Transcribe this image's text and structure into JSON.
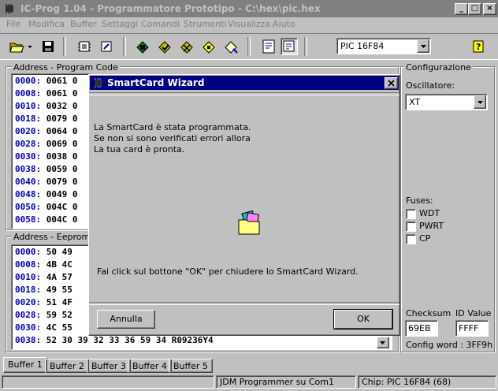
{
  "window": {
    "title": "IC-Prog 1.04 - Programmatore Prototipo - C:\\hex\\pic.hex",
    "buttons": [
      "_",
      "□",
      "×"
    ]
  },
  "menu": [
    "File",
    "Modifica",
    "Buffer",
    "Settaggi",
    "Comandi",
    "Strumenti",
    "Visualizza",
    "Aiuto"
  ],
  "toolbar": {
    "chip_select": "PIC 16F84",
    "icons": [
      "open-folder-icon",
      "dropdown-arrow-icon",
      "save-disk-icon",
      "chip-read-icon",
      "chip-write-icon",
      "program-icon",
      "verify-icon",
      "erase-icon",
      "blank-check-icon",
      "device-icon",
      "hex-view-icon",
      "window-icon",
      "help-icon"
    ]
  },
  "program_code": {
    "label": "Address - Program Code",
    "rows": [
      {
        "addr": "0000:",
        "data": "0061 0"
      },
      {
        "addr": "0008:",
        "data": "0061 0"
      },
      {
        "addr": "0010:",
        "data": "0032 0"
      },
      {
        "addr": "0018:",
        "data": "0079 0"
      },
      {
        "addr": "0020:",
        "data": "0064 0"
      },
      {
        "addr": "0028:",
        "data": "0069 0"
      },
      {
        "addr": "0030:",
        "data": "0038 0"
      },
      {
        "addr": "0038:",
        "data": "0059 0"
      },
      {
        "addr": "0040:",
        "data": "0079 0"
      },
      {
        "addr": "0048:",
        "data": "0049 0"
      },
      {
        "addr": "0050:",
        "data": "004C 0"
      },
      {
        "addr": "0058:",
        "data": "004C 0"
      }
    ]
  },
  "eeprom": {
    "label": "Address - Eeprom D",
    "rows": [
      {
        "addr": "0000:",
        "data": "50 49"
      },
      {
        "addr": "0008:",
        "data": "4B 4C"
      },
      {
        "addr": "0010:",
        "data": "4A 57"
      },
      {
        "addr": "0018:",
        "data": "49 55"
      },
      {
        "addr": "0020:",
        "data": "51 4F"
      },
      {
        "addr": "0028:",
        "data": "59 52"
      },
      {
        "addr": "0030:",
        "data": "4C 55"
      },
      {
        "addr": "0038:",
        "data": "52 30 39 32 33 36 59 34   R09236Y4"
      }
    ]
  },
  "config": {
    "title": "Configurazione",
    "osc_label": "Oscillatore:",
    "osc_value": "XT",
    "fuses_label": "Fuses:",
    "fuses": [
      "WDT",
      "PWRT",
      "CP"
    ],
    "checksum_label": "Checksum",
    "checksum_value": "69EB",
    "idvalue_label": "ID Value",
    "idvalue_value": "FFFF",
    "config_word": "Config word : 3FF9h"
  },
  "dialog": {
    "title": "SmartCard Wizard",
    "line1": "La SmartCard è stata programmata.",
    "line2": "Se non si sono verificati errori allora",
    "line3": "La tua card è pronta.",
    "hint": "Fai click sul bottone \"OK\" per chiudere lo SmartCard Wizard.",
    "cancel": "Annulla",
    "ok": "OK"
  },
  "tabs": [
    "Buffer 1",
    "Buffer 2",
    "Buffer 3",
    "Buffer 4",
    "Buffer 5"
  ],
  "status": {
    "programmer": "JDM Programmer su Com1",
    "chip": "Chip: PIC 16F84  (68)"
  },
  "colors": {
    "address": "#0000c0",
    "dialog_title": "#000080",
    "window_face": "#c0c0c0"
  }
}
